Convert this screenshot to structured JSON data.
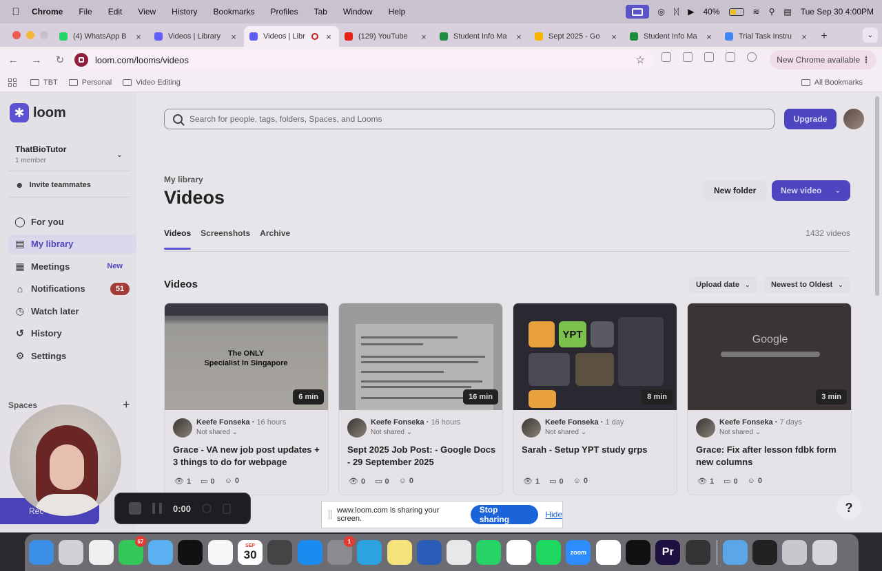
{
  "menubar": {
    "app": "Chrome",
    "items": [
      "File",
      "Edit",
      "View",
      "History",
      "Bookmarks",
      "Profiles",
      "Tab",
      "Window",
      "Help"
    ],
    "battery": "40%",
    "datetime": "Tue Sep 30  4:00PM"
  },
  "tabs": [
    {
      "title": "(4) WhatsApp B",
      "icon": "whatsapp-icon",
      "color": "#25d366"
    },
    {
      "title": "Videos | Library",
      "icon": "loom-icon",
      "color": "#625df5"
    },
    {
      "title": "Videos | Libr",
      "icon": "loom-icon",
      "color": "#625df5",
      "active": true,
      "recording": true
    },
    {
      "title": "(129) YouTube",
      "icon": "youtube-icon",
      "color": "#e62117"
    },
    {
      "title": "Student Info Ma",
      "icon": "sheets-icon",
      "color": "#1e8e3e"
    },
    {
      "title": "Sept 2025 - Go",
      "icon": "drive-icon",
      "color": "#f4b400"
    },
    {
      "title": "Student Info Ma",
      "icon": "sheets-icon",
      "color": "#1e8e3e"
    },
    {
      "title": "Trial Task Instru",
      "icon": "docs-icon",
      "color": "#4285f4"
    }
  ],
  "address": {
    "url": "loom.com/looms/videos",
    "new_chrome": "New Chrome available"
  },
  "bookmarks": {
    "items": [
      "TBT",
      "Personal",
      "Video Editing"
    ],
    "all": "All Bookmarks"
  },
  "sidebar": {
    "logo": "loom",
    "workspace": "ThatBioTutor",
    "members": "1 member",
    "invite": "Invite teammates",
    "nav": [
      {
        "label": "For you",
        "icon": "home-icon"
      },
      {
        "label": "My library",
        "icon": "library-icon",
        "selected": true
      },
      {
        "label": "Meetings",
        "icon": "calendar-icon",
        "badge": "New"
      },
      {
        "label": "Notifications",
        "icon": "bell-icon",
        "count": "51"
      },
      {
        "label": "Watch later",
        "icon": "clock-icon"
      },
      {
        "label": "History",
        "icon": "history-icon"
      },
      {
        "label": "Settings",
        "icon": "gear-icon"
      }
    ],
    "spaces": "Spaces",
    "record": "Rec"
  },
  "main": {
    "search_placeholder": "Search for people, tags, folders, Spaces, and Looms",
    "upgrade": "Upgrade",
    "breadcrumb": "My library",
    "title": "Videos",
    "new_folder": "New folder",
    "new_video": "New video",
    "tabs": [
      "Videos",
      "Screenshots",
      "Archive"
    ],
    "count": "1432 videos",
    "section": "Videos",
    "sort_field": "Upload date",
    "sort_order": "Newest to Oldest"
  },
  "videos": [
    {
      "author": "Keefe Fonseka",
      "when": "16 hours",
      "shared": "Not shared",
      "title": "Grace - VA new job post updates + 3 things to do for webpage",
      "duration": "6 min",
      "views": "1",
      "comments": "0",
      "reactions": "0",
      "thumb_text_1": "The ONLY",
      "thumb_text_2": "Specialist In Singapore"
    },
    {
      "author": "Keefe Fonseka",
      "when": "16 hours",
      "shared": "Not shared",
      "title": "Sept 2025 Job Post: - Google Docs - 29 September 2025",
      "duration": "16 min",
      "views": "0",
      "comments": "0",
      "reactions": "0"
    },
    {
      "author": "Keefe Fonseka",
      "when": "1 day",
      "shared": "Not shared",
      "title": "Sarah - Setup YPT study grps",
      "duration": "8 min",
      "views": "1",
      "comments": "0",
      "reactions": "0",
      "thumb_text_1": "YPT"
    },
    {
      "author": "Keefe Fonseka",
      "when": "7 days",
      "shared": "Not shared",
      "title": "Grace: Fix after lesson fdbk form new columns",
      "duration": "3 min",
      "views": "1",
      "comments": "0",
      "reactions": "0",
      "thumb_text_1": "Google"
    }
  ],
  "recorder": {
    "time": "0:00"
  },
  "sharebar": {
    "text": "www.loom.com is sharing your screen.",
    "stop": "Stop sharing",
    "hide": "Hide"
  },
  "help": "?",
  "dock": {
    "apps": [
      {
        "name": "finder-icon",
        "color": "#3a8ee6"
      },
      {
        "name": "launchpad-icon",
        "color": "#d0d0d6"
      },
      {
        "name": "clock-icon",
        "color": "#f0f0f0"
      },
      {
        "name": "messages-icon",
        "color": "#34c759",
        "badge": "67"
      },
      {
        "name": "maps-icon",
        "color": "#5ab0f0"
      },
      {
        "name": "capcut-icon",
        "color": "#111111"
      },
      {
        "name": "photos-icon",
        "color": "#f6f6f6"
      },
      {
        "name": "calendar-icon",
        "color": "#ffffff",
        "label_month": "SEP",
        "label_day": "30"
      },
      {
        "name": "calculator-icon",
        "color": "#444444"
      },
      {
        "name": "appstore-icon",
        "color": "#1a8cf0"
      },
      {
        "name": "system-settings-icon",
        "color": "#8a8a90",
        "badge": "1"
      },
      {
        "name": "telegram-icon",
        "color": "#2aa3e0"
      },
      {
        "name": "notes-icon",
        "color": "#f6e27a"
      },
      {
        "name": "word-icon",
        "color": "#2b5cb8"
      },
      {
        "name": "chrome-icon",
        "color": "#e8e8e8"
      },
      {
        "name": "whatsapp-icon",
        "color": "#25d366"
      },
      {
        "name": "google-play-icon",
        "color": "#ffffff"
      },
      {
        "name": "spotify-icon",
        "color": "#1ed760"
      },
      {
        "name": "zoom-icon",
        "color": "#2d8cff",
        "label": "zoom"
      },
      {
        "name": "slack-icon",
        "color": "#ffffff"
      },
      {
        "name": "bolt-icon",
        "color": "#111111"
      },
      {
        "name": "premiere-icon",
        "color": "#1e1040",
        "label": "Pr"
      },
      {
        "name": "quicktime-icon",
        "color": "#333333"
      },
      {
        "name": "folder-icon",
        "color": "#5aa6e8"
      },
      {
        "name": "terminal-icon",
        "color": "#222222"
      },
      {
        "name": "preview-icon",
        "color": "#c8c8cc"
      },
      {
        "name": "trash-icon",
        "color": "#d6d6da"
      }
    ]
  }
}
